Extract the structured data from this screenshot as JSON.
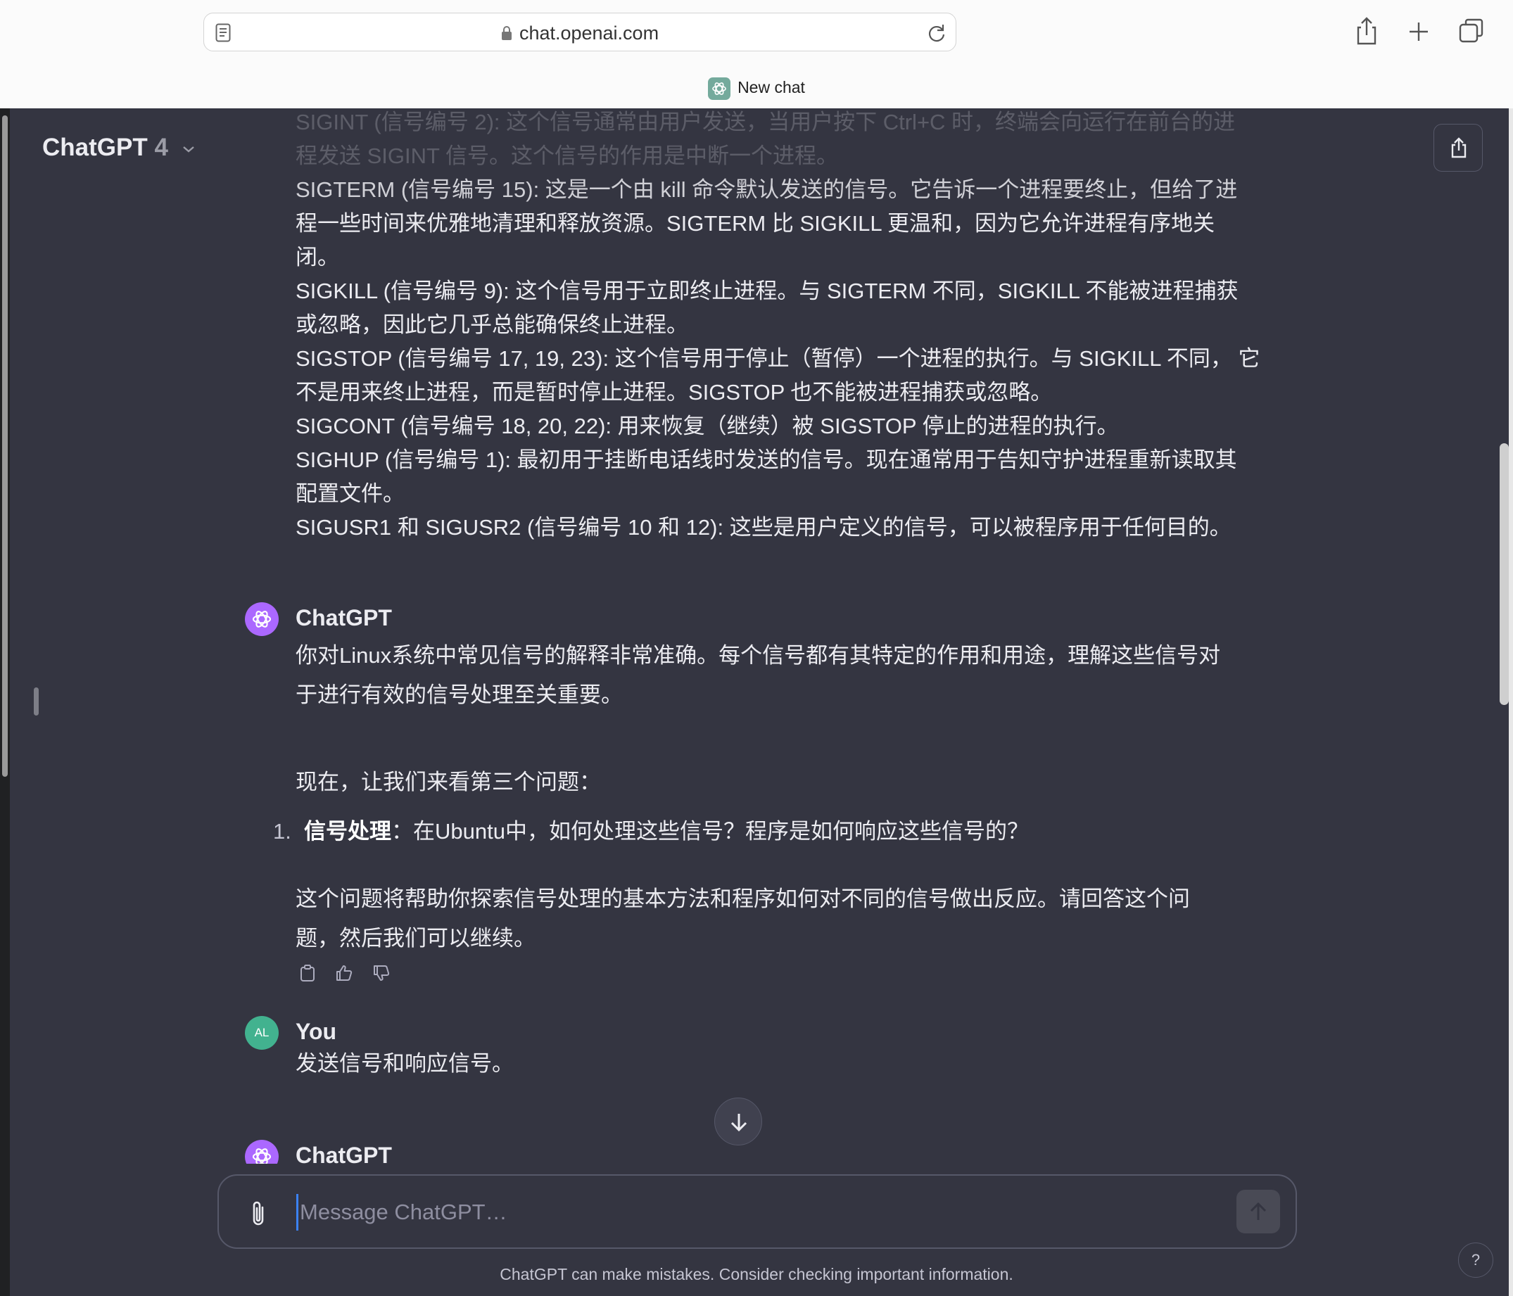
{
  "browser": {
    "url": "chat.openai.com",
    "tab_title": "New chat"
  },
  "header": {
    "model_name": "ChatGPT",
    "model_version": "4"
  },
  "messages": {
    "prev_user_lines": [
      "SIGINT (信号编号 2): 这个信号通常由用户发送，当用户按下 Ctrl+C 时，终端会向运行在前台的进",
      "程发送 SIGINT 信号。这个信号的作用是中断一个进程。",
      "SIGTERM (信号编号 15): 这是一个由 kill 命令默认发送的信号。它告诉一个进程要终止，但给了进",
      "程一些时间来优雅地清理和释放资源。SIGTERM 比 SIGKILL 更温和，因为它允许进程有序地关",
      "闭。",
      "SIGKILL (信号编号 9): 这个信号用于立即终止进程。与 SIGTERM 不同，SIGKILL 不能被进程捕获",
      "或忽略，因此它几乎总能确保终止进程。",
      "SIGSTOP (信号编号 17, 19, 23): 这个信号用于停止（暂停）一个进程的执行。与 SIGKILL 不同， 它",
      "不是用来终止进程，而是暂时停止进程。SIGSTOP 也不能被进程捕获或忽略。",
      "SIGCONT (信号编号 18, 20, 22): 用来恢复（继续）被 SIGSTOP 停止的进程的执行。",
      "SIGHUP (信号编号 1): 最初用于挂断电话线时发送的信号。现在通常用于告知守护进程重新读取其",
      "配置文件。",
      "SIGUSR1 和 SIGUSR2 (信号编号 10 和 12): 这些是用户定义的信号，可以被程序用于任何目的。"
    ],
    "assistant_name": "ChatGPT",
    "assistant_para1_line1": "你对Linux系统中常见信号的解释非常准确。每个信号都有其特定的作用和用途，理解这些信号对",
    "assistant_para1_line2": "于进行有效的信号处理至关重要。",
    "assistant_para2": "现在，让我们来看第三个问题：",
    "list_number": "1.",
    "list_bold": "信号处理",
    "list_rest": "：在Ubuntu中，如何处理这些信号？程序是如何响应这些信号的？",
    "assistant_para3_line1": "这个问题将帮助你探索信号处理的基本方法和程序如何对不同的信号做出反应。请回答这个问",
    "assistant_para3_line2": "题，然后我们可以继续。",
    "user_avatar": "AL",
    "user_name": "You",
    "user_message": "发送信号和响应信号。",
    "next_assistant_name": "ChatGPT"
  },
  "composer": {
    "placeholder": "Message ChatGPT…"
  },
  "footer": {
    "disclaimer": "ChatGPT can make mistakes. Consider checking important information.",
    "help_label": "?"
  }
}
